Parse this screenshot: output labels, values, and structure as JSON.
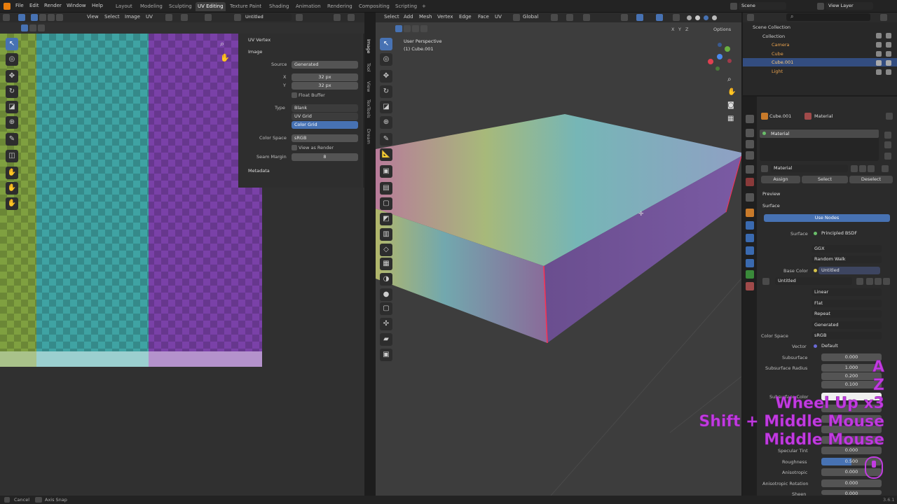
{
  "menu": [
    "File",
    "Edit",
    "Render",
    "Window",
    "Help"
  ],
  "workspaces": [
    "Layout",
    "Modeling",
    "Sculpting",
    "UV Editing",
    "Texture Paint",
    "Shading",
    "Animation",
    "Rendering",
    "Compositing",
    "Scripting",
    "+"
  ],
  "active_workspace": "UV Editing",
  "scene": "Scene",
  "view_layer": "View Layer",
  "uv_editor": {
    "header": [
      "View",
      "Select",
      "Image",
      "UV"
    ],
    "image_name": "Untitled",
    "sidebar": {
      "uv_vertex": "UV Vertex",
      "image_section": "Image",
      "source_label": "Source",
      "source": "Generated",
      "x_label": "X",
      "x": "32 px",
      "y_label": "Y",
      "y": "32 px",
      "float_buffer": "Float Buffer",
      "type_label": "Type",
      "types": [
        "Blank",
        "UV Grid",
        "Color Grid"
      ],
      "color_space_label": "Color Space",
      "color_space": "sRGB",
      "view_as_render": "View as Render",
      "seam_label": "Seam Margin",
      "seam": "8",
      "metadata": "Metadata"
    },
    "tabs": [
      "Image",
      "Tool",
      "View",
      "TexTools",
      "Dream"
    ]
  },
  "viewport": {
    "header": [
      "Select",
      "Add",
      "Mesh",
      "Vertex",
      "Edge",
      "Face",
      "UV"
    ],
    "orientation": "Global",
    "options": "Options",
    "perspective": "User Perspective",
    "object": "(1) Cube.001",
    "axes": [
      "X",
      "Y",
      "Z"
    ]
  },
  "outliner": {
    "root": "Scene Collection",
    "items": [
      "Collection",
      "Camera",
      "Cube",
      "Cube.001",
      "Light"
    ]
  },
  "properties": {
    "object": "Cube.001",
    "material_tab": "Material",
    "slot": "Material",
    "mat_name": "Material",
    "assign": "Assign",
    "select": "Select",
    "deselect": "Deselect",
    "preview": "Preview",
    "surface_section": "Surface",
    "use_nodes": "Use Nodes",
    "surface_label": "Surface",
    "surface": "Principled BSDF",
    "distribution": "GGX",
    "subsurface_method": "Random Walk",
    "base_color_label": "Base Color",
    "base_color": "Untitled",
    "image_name": "Untitled",
    "interp": "Linear",
    "proj": "Flat",
    "ext": "Repeat",
    "src": "Generated",
    "cs_label": "Color Space",
    "cs": "sRGB",
    "vector_label": "Vector",
    "vector": "Default",
    "rows": [
      {
        "label": "Subsurface",
        "value": "0.000"
      },
      {
        "label": "Subsurface Radius",
        "value": "1.000"
      },
      {
        "label": "",
        "value": "0.200"
      },
      {
        "label": "",
        "value": "0.100"
      },
      {
        "label": "Subsurface Color",
        "value": ""
      },
      {
        "label": "Specular Tint",
        "value": "0.000"
      },
      {
        "label": "Roughness",
        "value": "0.500"
      },
      {
        "label": "Anisotropic",
        "value": "0.000"
      },
      {
        "label": "Anisotropic Rotation",
        "value": "0.000"
      },
      {
        "label": "Sheen",
        "value": "0.000"
      }
    ]
  },
  "status": {
    "cancel": "Cancel",
    "axis_snap": "Axis Snap",
    "version": "3.6.1"
  },
  "keystrokes": [
    "A",
    "Z",
    "Wheel Up x3",
    "Shift + Middle Mouse",
    "Middle Mouse"
  ]
}
